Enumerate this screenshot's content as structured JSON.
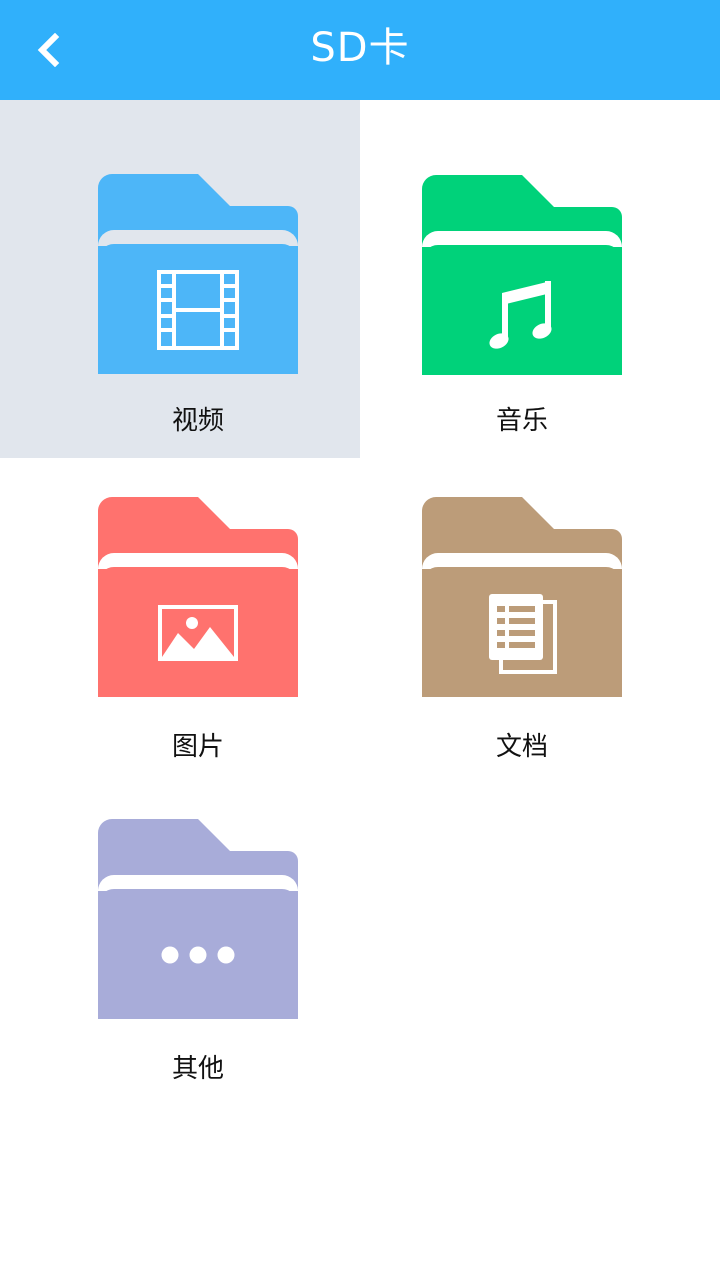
{
  "header": {
    "title": "SD卡",
    "background_color": "#30b0fb",
    "back_icon": "chevron-left-icon"
  },
  "categories": [
    {
      "label": "视频",
      "color": "#4db6f8",
      "icon": "film-icon",
      "selected": true
    },
    {
      "label": "音乐",
      "color": "#00d27a",
      "icon": "music-note-icon",
      "selected": false
    },
    {
      "label": "图片",
      "color": "#ff726e",
      "icon": "image-icon",
      "selected": false
    },
    {
      "label": "文档",
      "color": "#bc9c79",
      "icon": "document-icon",
      "selected": false
    },
    {
      "label": "其他",
      "color": "#a8acd9",
      "icon": "more-dots-icon",
      "selected": false
    }
  ],
  "colors": {
    "selected_tile_background": "#e1e6ed",
    "page_background": "#ffffff"
  }
}
